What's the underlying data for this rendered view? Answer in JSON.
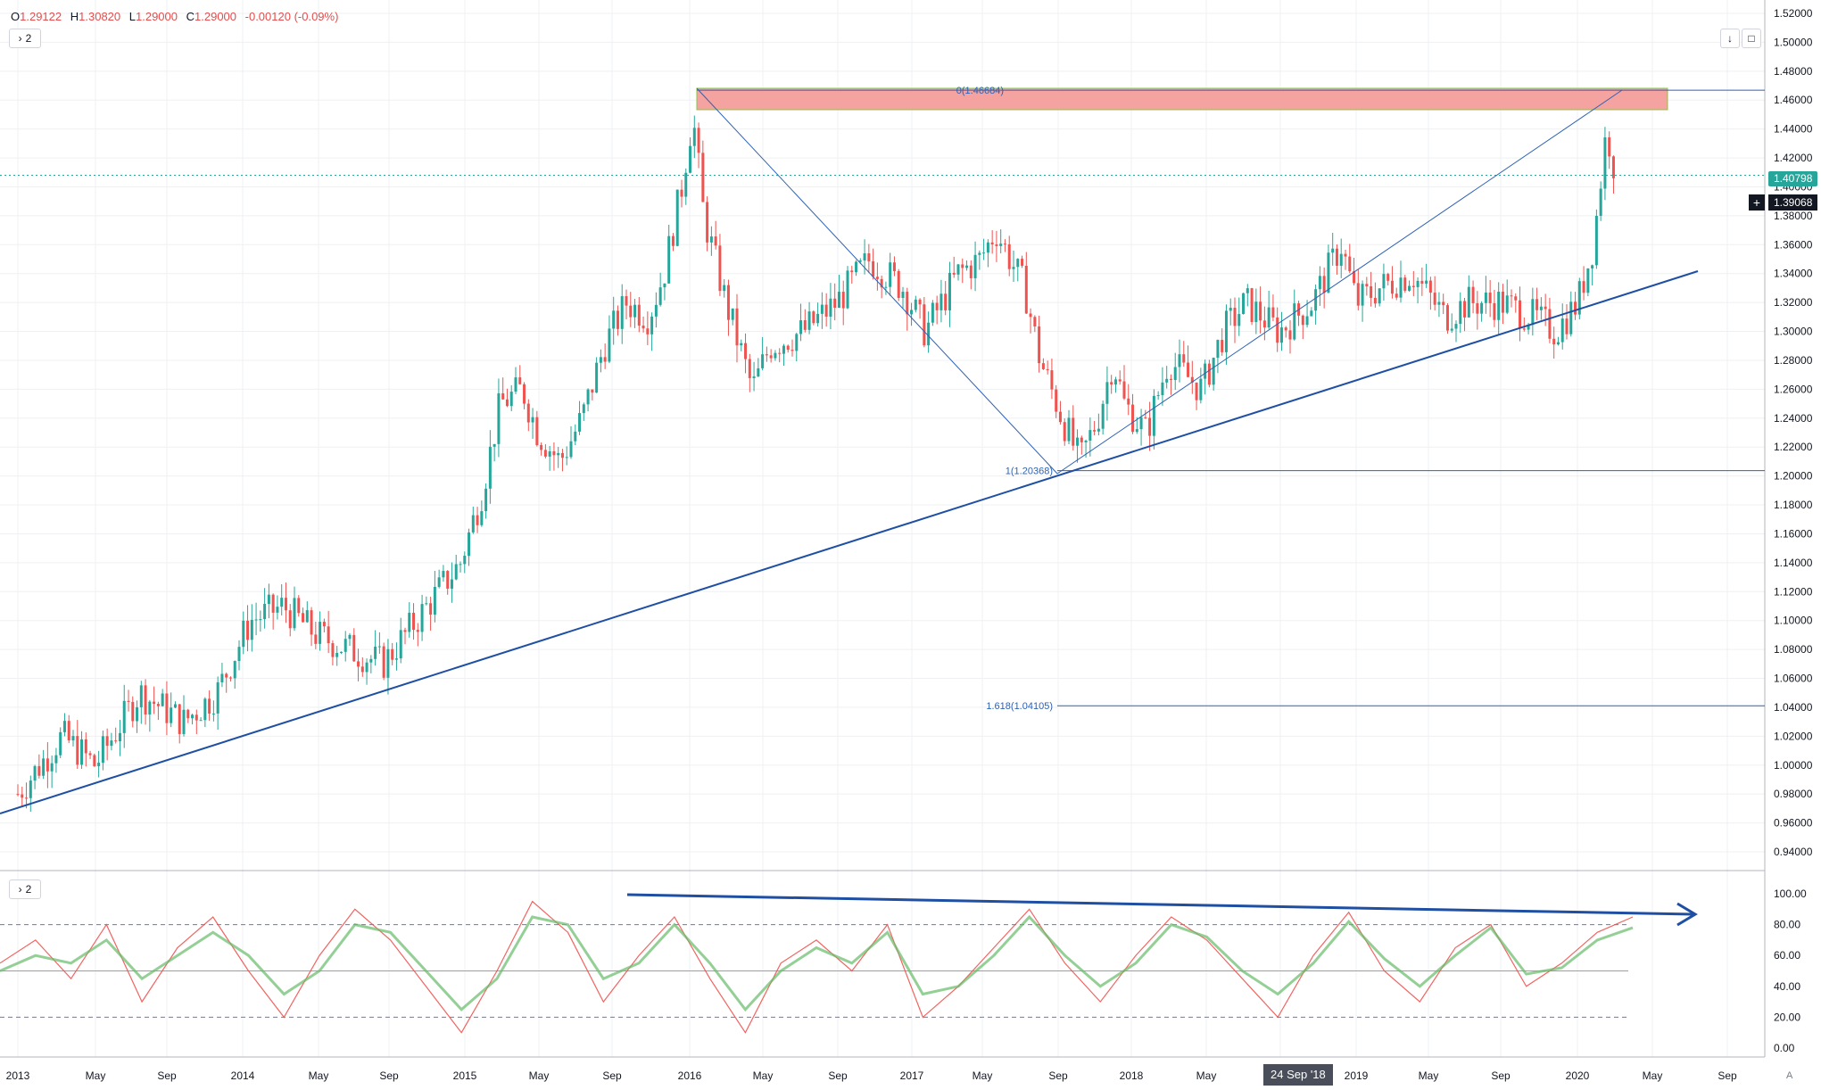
{
  "header": {
    "open_label": "O",
    "open": "1.29122",
    "high_label": "H",
    "high": "1.30820",
    "low_label": "L",
    "low": "1.29000",
    "close_label": "C",
    "close": "1.29000",
    "change": "-0.00120 (-0.09%)",
    "collapse_label": "2"
  },
  "toolbar": {
    "arrow_down_icon": "↓",
    "fullscreen_icon": "□"
  },
  "oscillator": {
    "collapse_label": "2"
  },
  "current_price": {
    "value": "1.40798",
    "color": "#26a69a"
  },
  "crosshair_price": {
    "value": "1.39068"
  },
  "crosshair_date": {
    "value": "24 Sep '18"
  },
  "auto_label": "A",
  "colors": {
    "up": "#26a69a",
    "down": "#ef5350",
    "grid": "#eef0f3",
    "trend": "#1e4fa3",
    "fib": "#2e62b3",
    "zone": "#f4a3a0",
    "stoch_k": "#66bb6a",
    "stoch_d": "#ef5350"
  },
  "chart_data": [
    {
      "type": "candlestick",
      "title": "",
      "ylim": [
        0.94,
        1.52
      ],
      "price_ticks": [
        "1.52000",
        "1.50000",
        "1.48000",
        "1.46000",
        "1.44000",
        "1.42000",
        "1.40000",
        "1.38000",
        "1.36000",
        "1.34000",
        "1.32000",
        "1.30000",
        "1.28000",
        "1.26000",
        "1.24000",
        "1.22000",
        "1.20000",
        "1.18000",
        "1.16000",
        "1.14000",
        "1.12000",
        "1.10000",
        "1.08000",
        "1.06000",
        "1.04000",
        "1.02000",
        "1.00000",
        "0.98000",
        "0.96000",
        "0.94000"
      ],
      "x_ticks": [
        "2013",
        "May",
        "Sep",
        "2014",
        "May",
        "Sep",
        "2015",
        "May",
        "Sep",
        "2016",
        "May",
        "Sep",
        "2017",
        "May",
        "Sep",
        "2018",
        "May",
        "Sep",
        "2019",
        "May",
        "Sep",
        "2020",
        "May",
        "Sep"
      ],
      "x_range": [
        2013.0,
        2021.0
      ],
      "series_points": [
        [
          2013.0,
          0.98
        ],
        [
          2013.2,
          1.02
        ],
        [
          2013.35,
          1.0
        ],
        [
          2013.55,
          1.05
        ],
        [
          2013.75,
          1.03
        ],
        [
          2013.9,
          1.05
        ],
        [
          2014.05,
          1.1
        ],
        [
          2014.2,
          1.11
        ],
        [
          2014.35,
          1.09
        ],
        [
          2014.5,
          1.08
        ],
        [
          2014.65,
          1.07
        ],
        [
          2014.8,
          1.1
        ],
        [
          2015.0,
          1.14
        ],
        [
          2015.1,
          1.19
        ],
        [
          2015.18,
          1.25
        ],
        [
          2015.28,
          1.26
        ],
        [
          2015.35,
          1.23
        ],
        [
          2015.45,
          1.21
        ],
        [
          2015.55,
          1.24
        ],
        [
          2015.65,
          1.29
        ],
        [
          2015.75,
          1.32
        ],
        [
          2015.85,
          1.31
        ],
        [
          2015.92,
          1.34
        ],
        [
          2016.0,
          1.4
        ],
        [
          2016.05,
          1.45
        ],
        [
          2016.1,
          1.38
        ],
        [
          2016.2,
          1.32
        ],
        [
          2016.32,
          1.26
        ],
        [
          2016.4,
          1.29
        ],
        [
          2016.55,
          1.3
        ],
        [
          2016.7,
          1.32
        ],
        [
          2016.85,
          1.35
        ],
        [
          2017.0,
          1.33
        ],
        [
          2017.1,
          1.3
        ],
        [
          2017.25,
          1.34
        ],
        [
          2017.35,
          1.35
        ],
        [
          2017.42,
          1.37
        ],
        [
          2017.55,
          1.33
        ],
        [
          2017.62,
          1.28
        ],
        [
          2017.72,
          1.24
        ],
        [
          2017.8,
          1.21
        ],
        [
          2017.88,
          1.24
        ],
        [
          2017.95,
          1.28
        ],
        [
          2018.0,
          1.25
        ],
        [
          2018.1,
          1.23
        ],
        [
          2018.2,
          1.28
        ],
        [
          2018.35,
          1.26
        ],
        [
          2018.45,
          1.3
        ],
        [
          2018.55,
          1.32
        ],
        [
          2018.7,
          1.3
        ],
        [
          2018.85,
          1.32
        ],
        [
          2018.98,
          1.36
        ],
        [
          2019.05,
          1.32
        ],
        [
          2019.15,
          1.33
        ],
        [
          2019.3,
          1.34
        ],
        [
          2019.45,
          1.31
        ],
        [
          2019.55,
          1.32
        ],
        [
          2019.7,
          1.32
        ],
        [
          2019.85,
          1.31
        ],
        [
          2019.95,
          1.3
        ],
        [
          2020.05,
          1.32
        ],
        [
          2020.12,
          1.36
        ],
        [
          2020.18,
          1.44
        ],
        [
          2020.22,
          1.41
        ]
      ],
      "annotations": [
        {
          "label": "0(1.46684)",
          "value": 1.46684
        },
        {
          "label": "1(1.20368)",
          "value": 1.20368
        },
        {
          "label": "1.618(1.04105)",
          "value": 1.04105
        }
      ]
    },
    {
      "type": "line",
      "title": "",
      "ylim": [
        0,
        100
      ],
      "y_ticks": [
        "100.00",
        "80.00",
        "60.00",
        "40.00",
        "20.00",
        "0.00"
      ],
      "levels": [
        80,
        50,
        20
      ],
      "series": [
        {
          "values": [
            55,
            70,
            45,
            80,
            30,
            65,
            85,
            50,
            20,
            60,
            90,
            70,
            40,
            10,
            50,
            95,
            75,
            30,
            60,
            85,
            45,
            10,
            55,
            70,
            50,
            80,
            20,
            40,
            65,
            90,
            55,
            30,
            60,
            85,
            70,
            45,
            20,
            60,
            88,
            50,
            30,
            65,
            80,
            40,
            55,
            75,
            85
          ]
        },
        {
          "values": [
            50,
            60,
            55,
            70,
            45,
            60,
            75,
            60,
            35,
            50,
            80,
            75,
            50,
            25,
            45,
            85,
            80,
            45,
            55,
            80,
            55,
            25,
            50,
            65,
            55,
            75,
            35,
            40,
            60,
            85,
            60,
            40,
            55,
            80,
            72,
            50,
            35,
            55,
            82,
            58,
            40,
            60,
            78,
            48,
            52,
            70,
            78
          ]
        }
      ]
    }
  ]
}
